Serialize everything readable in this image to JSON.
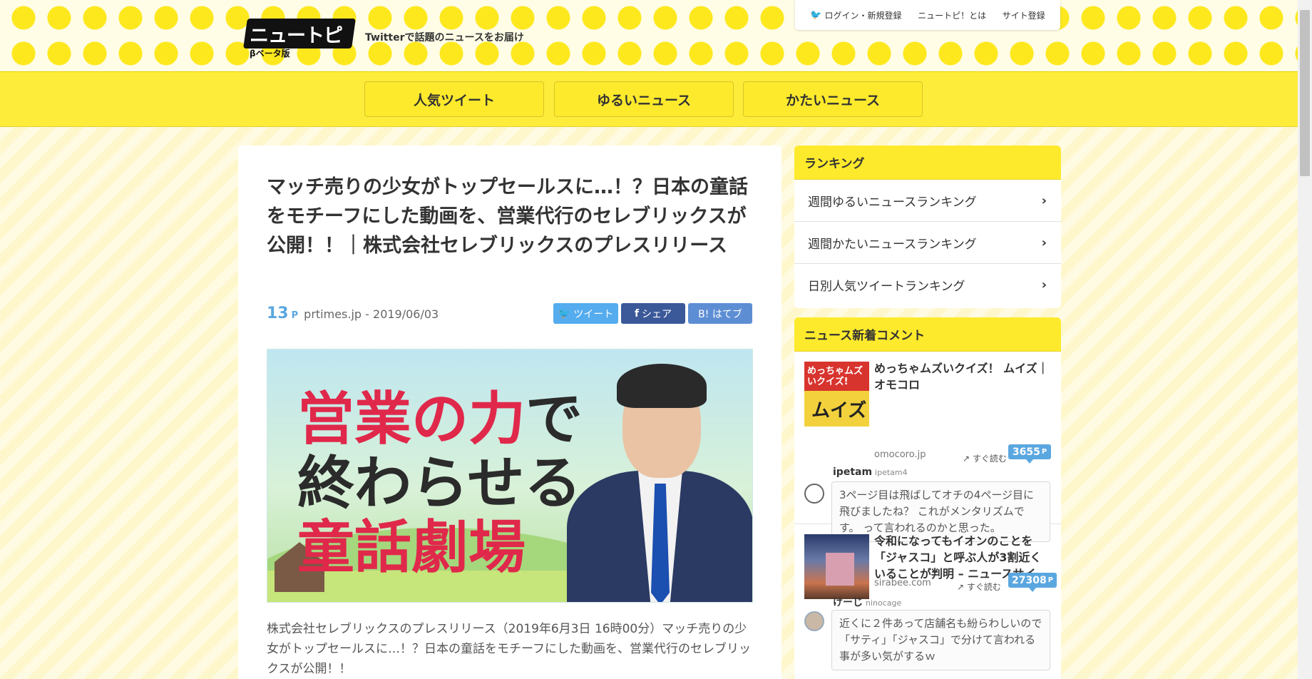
{
  "header": {
    "logo_text": "ニュートピ",
    "logo_bang": "!",
    "logo_beta": "βベータ版",
    "tagline": "Twitterで話題のニュースをお届け",
    "login": "ログイン・新規登録",
    "about": "ニュートピ！とは",
    "register": "サイト登録"
  },
  "nav": [
    "人気ツイート",
    "ゆるいニュース",
    "かたいニュース"
  ],
  "article": {
    "title": "マッチ売りの少女がトップセールスに…！？日本の童話をモチーフにした動画を、営業代行のセレブリックスが公開！！｜株式会社セレブリックスのプレスリリース",
    "points": "13",
    "points_unit": "P",
    "source": "prtimes.jp - 2019/06/03",
    "share_tweet": "ツイート",
    "share_fb": "シェア",
    "share_hatena": "B! はてブ",
    "hero_line1_red": "営業の力",
    "hero_line1_dark": "で",
    "hero_line2": "終わらせる",
    "hero_line3": "童話劇場",
    "excerpt": "株式会社セレブリックスのプレスリリース（2019年6月3日 16時00分）マッチ売りの少女がトップセールスに…！？日本の童話をモチーフにした動画を、営業代行のセレブリックスが公開！！"
  },
  "ranking": {
    "heading": "ランキング",
    "items": [
      "週間ゆるいニュースランキング",
      "週間かたいニュースランキング",
      "日別人気ツイートランキング"
    ]
  },
  "comments": {
    "heading": "ニュース新着コメント",
    "read_label": "すぐ読む",
    "items": [
      {
        "thumb_text": "めっちゃムズいクイズ!",
        "thumb_big": "ムイズ",
        "title": "めっちゃムズいクイズ！ ムイズ｜オモコロ",
        "source": "omocoro.jp",
        "points": "3655",
        "unit": "P",
        "user": "ipetam",
        "handle": "ipetam4",
        "comment": "3ページ目は飛ばしてオチの4ページ目に飛びましたね？ これがメンタリズムです。 って言われるのかと思った。"
      },
      {
        "title": "令和になってもイオンのことを「ジャスコ」と呼ぶ人が3割近くいることが判明 – ニュースサイ…",
        "source": "sirabee.com",
        "points": "27308",
        "unit": "P",
        "user": "けーじ",
        "handle": "ninocage",
        "comment": "近くに２件あって店舗名も紛らわしいので「サティ」「ジャスコ」で分けて言われる事が多い気がするｗ"
      }
    ]
  }
}
